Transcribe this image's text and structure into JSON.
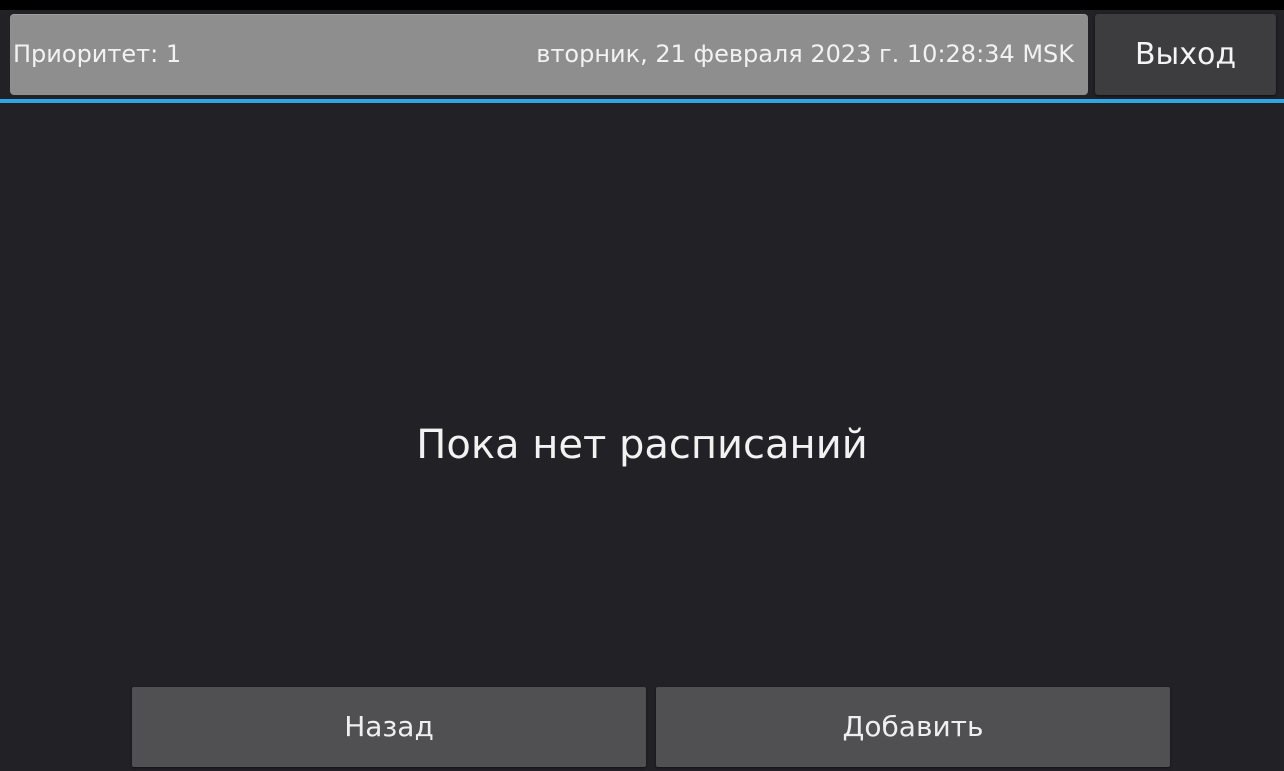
{
  "header": {
    "priority": "Приоритет: 1",
    "datetime": "вторник, 21 февраля 2023 г. 10:28:34 MSK",
    "exit_label": "Выход"
  },
  "main": {
    "empty_message": "Пока нет расписаний"
  },
  "footer": {
    "back_label": "Назад",
    "add_label": "Добавить"
  },
  "colors": {
    "background": "#222126",
    "status_bar": "#8e8e8e",
    "accent": "#2ea6e2",
    "button": "#505052",
    "exit_button": "#3d3d3f"
  }
}
